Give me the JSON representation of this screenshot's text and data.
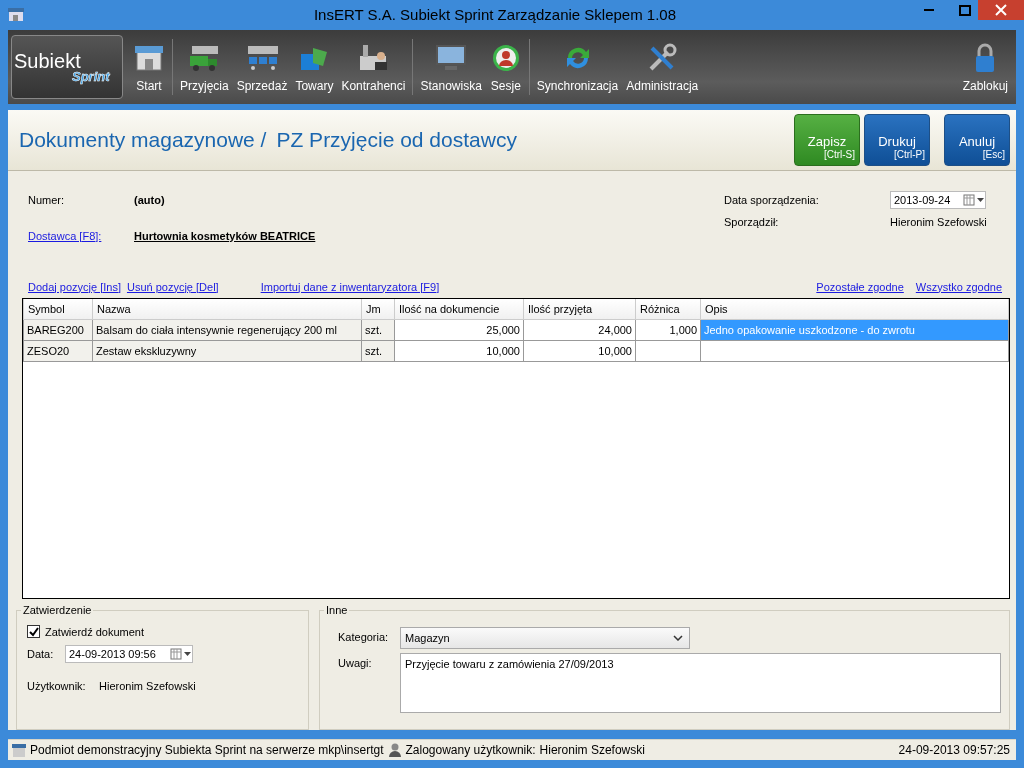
{
  "window": {
    "title": "InsERT S.A. Subiekt Sprint Zarządzanie Sklepem 1.08"
  },
  "toolbar": {
    "logo": {
      "line1": "Subiekt",
      "line2": "Sprint"
    },
    "items": [
      {
        "label": "Start",
        "separator_after": true
      },
      {
        "label": "Przyjęcia",
        "separator_after": false
      },
      {
        "label": "Sprzedaż",
        "separator_after": false
      },
      {
        "label": "Towary",
        "separator_after": false
      },
      {
        "label": "Kontrahenci",
        "separator_after": true
      },
      {
        "label": "Stanowiska",
        "separator_after": false
      },
      {
        "label": "Sesje",
        "separator_after": true
      },
      {
        "label": "Synchronizacja",
        "separator_after": false
      },
      {
        "label": "Administracja",
        "separator_after": false
      }
    ],
    "lock": {
      "label": "Zablokuj"
    }
  },
  "header": {
    "breadcrumb": "Dokumenty magazynowe /",
    "title": "PZ Przyjęcie od dostawcy",
    "buttons": [
      {
        "label": "Zapisz",
        "shortcut": "[Ctrl-S]",
        "kind": "save"
      },
      {
        "label": "Drukuj",
        "shortcut": "[Ctrl-P]",
        "kind": "print"
      },
      {
        "label": "Anuluj",
        "shortcut": "[Esc]",
        "kind": "cancel"
      }
    ]
  },
  "form": {
    "number_label": "Numer:",
    "number_value": "(auto)",
    "supplier_link": "Dostawca [F8]:",
    "supplier_value": "Hurtownia kosmetyków BEATRICE",
    "date_label": "Data sporządzenia:",
    "date_value": "2013-09-24",
    "author_label": "Sporządził:",
    "author_value": "Hieronim Szefowski"
  },
  "actions_left": [
    "Dodaj pozycję [Ins]",
    "Usuń pozycję [Del]",
    "Importuj dane z inwentaryzatora [F9]"
  ],
  "actions_right": [
    "Pozostałe zgodne",
    "Wszystko zgodne"
  ],
  "table": {
    "columns": [
      {
        "label": "Symbol",
        "kind": "text"
      },
      {
        "label": "Nazwa",
        "kind": "text"
      },
      {
        "label": "Jm",
        "kind": "text"
      },
      {
        "label": "Ilość na dokumencie",
        "kind": "number"
      },
      {
        "label": "Ilość przyjęta",
        "kind": "number"
      },
      {
        "label": "Różnica",
        "kind": "number"
      },
      {
        "label": "Opis",
        "kind": "text"
      }
    ],
    "rows": [
      {
        "selected": true,
        "cells": [
          "BAREG200",
          "Balsam do ciała intensywnie regenerujący 200 ml",
          "szt.",
          "25,000",
          "24,000",
          "1,000",
          "Jedno opakowanie uszkodzone - do zwrotu"
        ]
      },
      {
        "selected": false,
        "cells": [
          "ZESO20",
          "Zestaw ekskluzywny",
          "szt.",
          "10,000",
          "10,000",
          "",
          ""
        ]
      }
    ]
  },
  "approval": {
    "title": "Zatwierdzenie",
    "checkbox": {
      "label": "Zatwierdź dokument",
      "checked": true
    },
    "date_label": "Data:",
    "date_value": "24-09-2013 09:56",
    "user_label": "Użytkownik:",
    "user_value": "Hieronim Szefowski"
  },
  "other": {
    "title": "Inne",
    "category_label": "Kategoria:",
    "category_value": "Magazyn",
    "notes_label": "Uwagi:",
    "notes_value": "Przyjęcie towaru z zamówienia 27/09/2013"
  },
  "status_bar": {
    "database": "Podmiot demonstracyjny Subiekta Sprint na serwerze mkp\\insertgt",
    "user_label": "Zalogowany użytkownik:",
    "user_value": "Hieronim Szefowski",
    "datetime": "24-09-2013 09:57:25"
  }
}
